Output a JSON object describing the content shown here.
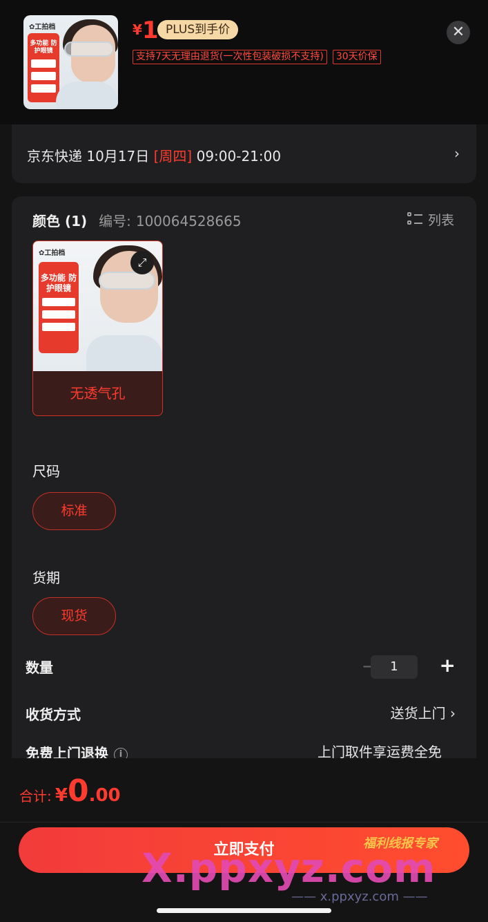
{
  "header": {
    "price_symbol": "¥",
    "price_value": "1",
    "plus_tag": "PLUS到手价",
    "tags": [
      "支持7天无理由退货(一次性包装破损不支持)",
      "30天价保"
    ],
    "close_icon": "close-icon"
  },
  "thumbnail": {
    "brand": "✿工拍档",
    "panel_text": "多功能 防护眼镜"
  },
  "delivery": {
    "carrier": "京东快递",
    "date": "10月17日",
    "weekday": "[周四]",
    "time": "09:00-21:00"
  },
  "color_section": {
    "title": "颜色 (1)",
    "code_label": "编号:",
    "code_value": "100064528665",
    "list_label": "列表",
    "sku_label": "无透气孔"
  },
  "size_section": {
    "title": "尺码",
    "option": "标准"
  },
  "stock_section": {
    "title": "货期",
    "option": "现货"
  },
  "quantity": {
    "label": "数量",
    "value": "1",
    "minus": "−",
    "plus": "+"
  },
  "shipping": {
    "label": "收货方式",
    "value": "送货上门"
  },
  "return_service": {
    "label": "免费上门退换",
    "value": "上门取件享运费全免"
  },
  "footer": {
    "total_label": "合计:",
    "total_symbol": "¥",
    "total_int": "0",
    "total_dec": ".00",
    "pay_button": "立即支付"
  },
  "watermarks": {
    "logo_text": "福利线报专家",
    "big_text": "X.ppxyz.com",
    "small_text": "—— x.ppxyz.com ——"
  },
  "colors": {
    "accent_red": "#ff3b30",
    "plus_gold": "#f5d8a6",
    "background": "#141414",
    "card": "#1f1f21"
  }
}
